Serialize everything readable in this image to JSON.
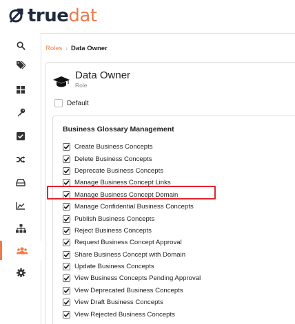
{
  "app": {
    "logo_text_part1": "true",
    "logo_text_part2": "dat",
    "brand_color": "#ee7a4b"
  },
  "sidebar": {
    "items": [
      {
        "icon": "search-icon",
        "active": false
      },
      {
        "icon": "tags-icon",
        "active": false
      },
      {
        "icon": "grid-icon",
        "active": false
      },
      {
        "icon": "key-icon",
        "active": false
      },
      {
        "icon": "check-square-icon",
        "active": false
      },
      {
        "icon": "shuffle-icon",
        "active": false
      },
      {
        "icon": "drive-icon",
        "active": false
      },
      {
        "icon": "area-chart-icon",
        "active": false
      },
      {
        "icon": "sitemap-icon",
        "active": false
      },
      {
        "icon": "users-icon",
        "active": true
      },
      {
        "icon": "cog-icon",
        "active": false
      }
    ]
  },
  "breadcrumb": {
    "parent": "Roles",
    "current": "Data Owner"
  },
  "role": {
    "title": "Data Owner",
    "subtitle": "Role",
    "default_label": "Default",
    "default_checked": false
  },
  "permissions_group": {
    "title": "Business Glossary Management",
    "items": [
      {
        "label": "Create Business Concepts",
        "checked": true
      },
      {
        "label": "Delete Business Concepts",
        "checked": true
      },
      {
        "label": "Deprecate Business Concepts",
        "checked": true
      },
      {
        "label": "Manage Business Concept Links",
        "checked": true
      },
      {
        "label": "Manage Business Concept Domain",
        "checked": true,
        "highlighted": true
      },
      {
        "label": "Manage Confidential Business Concepts",
        "checked": true
      },
      {
        "label": "Publish Business Concepts",
        "checked": true
      },
      {
        "label": "Reject Business Concepts",
        "checked": true
      },
      {
        "label": "Request Business Concept Approval",
        "checked": true
      },
      {
        "label": "Share Business Concept with Domain",
        "checked": true
      },
      {
        "label": "Update Business Concepts",
        "checked": true
      },
      {
        "label": "View Business Concepts Pending Approval",
        "checked": true
      },
      {
        "label": "View Deprecated Business Concepts",
        "checked": true
      },
      {
        "label": "View Draft Business Concepts",
        "checked": true
      },
      {
        "label": "View Rejected Business Concepts",
        "checked": true
      }
    ],
    "highlight_color": "#e1242f"
  }
}
